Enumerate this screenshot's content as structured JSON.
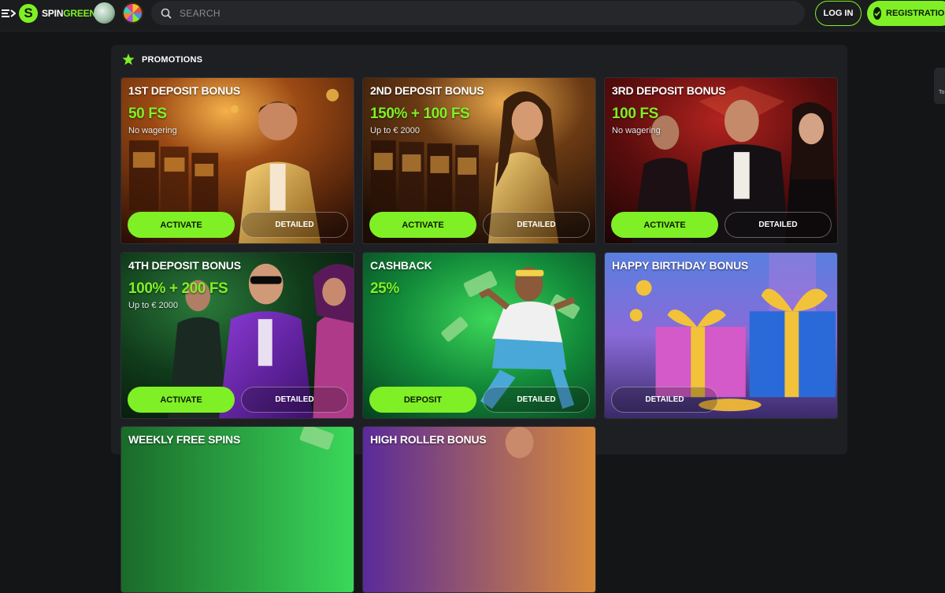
{
  "header": {
    "logo": {
      "part1": "SPIN",
      "part2": "GREEN"
    },
    "search": {
      "placeholder": "SEARCH"
    },
    "login_label": "LOG IN",
    "registration_label": "REGISTRATION"
  },
  "side_tab": {
    "label": "To"
  },
  "promotions": {
    "title": "PROMOTIONS",
    "cards": [
      {
        "title": "1ST DEPOSIT BONUS",
        "offer": "50 FS",
        "subtitle": "No wagering",
        "primary_label": "ACTIVATE",
        "detailed_label": "DETAILED"
      },
      {
        "title": "2ND DEPOSIT BONUS",
        "offer": "150% + 100 FS",
        "subtitle": "Up to € 2000",
        "primary_label": "ACTIVATE",
        "detailed_label": "DETAILED"
      },
      {
        "title": "3RD DEPOSIT BONUS",
        "offer": "100 FS",
        "subtitle": "No wagering",
        "primary_label": "ACTIVATE",
        "detailed_label": "DETAILED"
      },
      {
        "title": "4TH DEPOSIT BONUS",
        "offer": "100% + 200 FS",
        "subtitle": "Up to € 2000",
        "primary_label": "ACTIVATE",
        "detailed_label": "DETAILED"
      },
      {
        "title": "CASHBACK",
        "offer": "25%",
        "subtitle": "",
        "primary_label": "DEPOSIT",
        "detailed_label": "DETAILED"
      },
      {
        "title": "HAPPY BIRTHDAY BONUS",
        "offer": "",
        "subtitle": "",
        "primary_label": "",
        "detailed_label": "DETAILED"
      },
      {
        "title": "WEEKLY FREE SPINS",
        "offer": "",
        "subtitle": "",
        "primary_label": "",
        "detailed_label": ""
      },
      {
        "title": "HIGH ROLLER BONUS",
        "offer": "",
        "subtitle": "",
        "primary_label": "",
        "detailed_label": ""
      }
    ]
  },
  "colors": {
    "accent": "#7ff025",
    "background": "#141517",
    "panel": "#1e1f22"
  }
}
